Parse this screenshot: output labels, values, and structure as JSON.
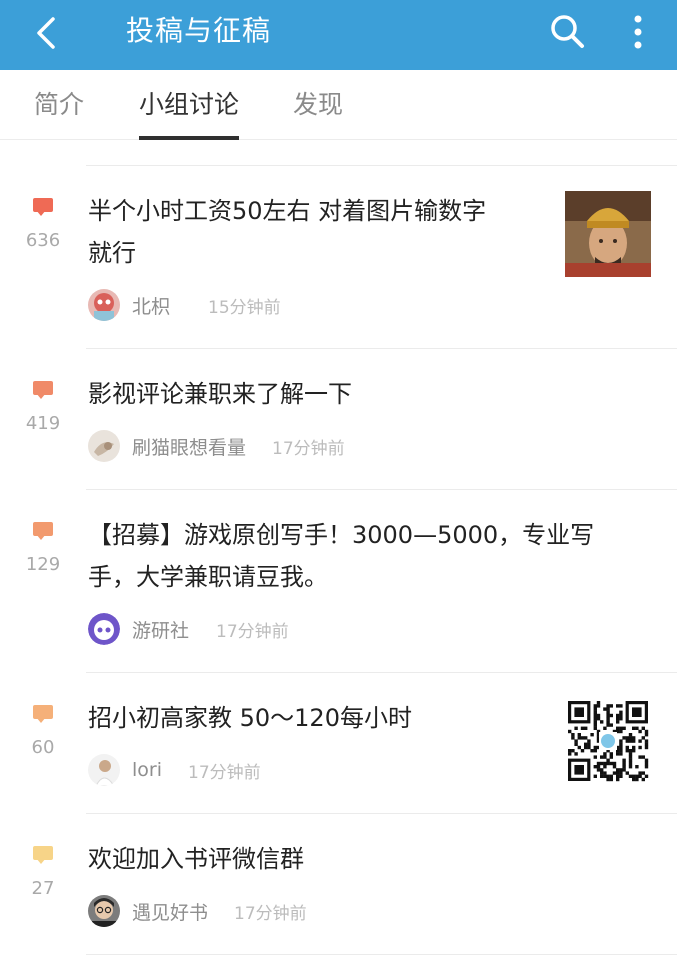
{
  "header": {
    "title": "投稿与征稿",
    "back_icon": "back-arrow-icon",
    "search_icon": "search-icon",
    "more_icon": "more-vertical-icon",
    "bar_color": "#3c9fd8"
  },
  "tabs": [
    {
      "label": "简介",
      "active": false
    },
    {
      "label": "小组讨论",
      "active": true
    },
    {
      "label": "发现",
      "active": false
    }
  ],
  "topics": [
    {
      "count": "636",
      "title_lines": [
        "半个小时工资50左右 对着图片输数字",
        "就行"
      ],
      "author": "北枳",
      "time": "15分钟前",
      "bubble_color": "#ef6a55",
      "thumbnail": "portrait-photo"
    },
    {
      "count": "419",
      "title_lines": [
        "影视评论兼职来了解一下"
      ],
      "author": "刷猫眼想看量",
      "time": "17分钟前",
      "bubble_color": "#f08a68"
    },
    {
      "count": "129",
      "title_lines": [
        "【招募】游戏原创写手！3000—5000，专业写",
        "手，大学兼职请豆我。"
      ],
      "author": "游研社",
      "time": "17分钟前",
      "bubble_color": "#f29a6e"
    },
    {
      "count": "60",
      "title_lines": [
        "招小初高家教 50～120每小时"
      ],
      "author": "lori",
      "time": "17分钟前",
      "bubble_color": "#f5b079",
      "thumbnail": "qr-code"
    },
    {
      "count": "27",
      "title_lines": [
        "欢迎加入书评微信群"
      ],
      "author": "遇见好书",
      "time": "17分钟前",
      "bubble_color": "#f7d488"
    }
  ]
}
